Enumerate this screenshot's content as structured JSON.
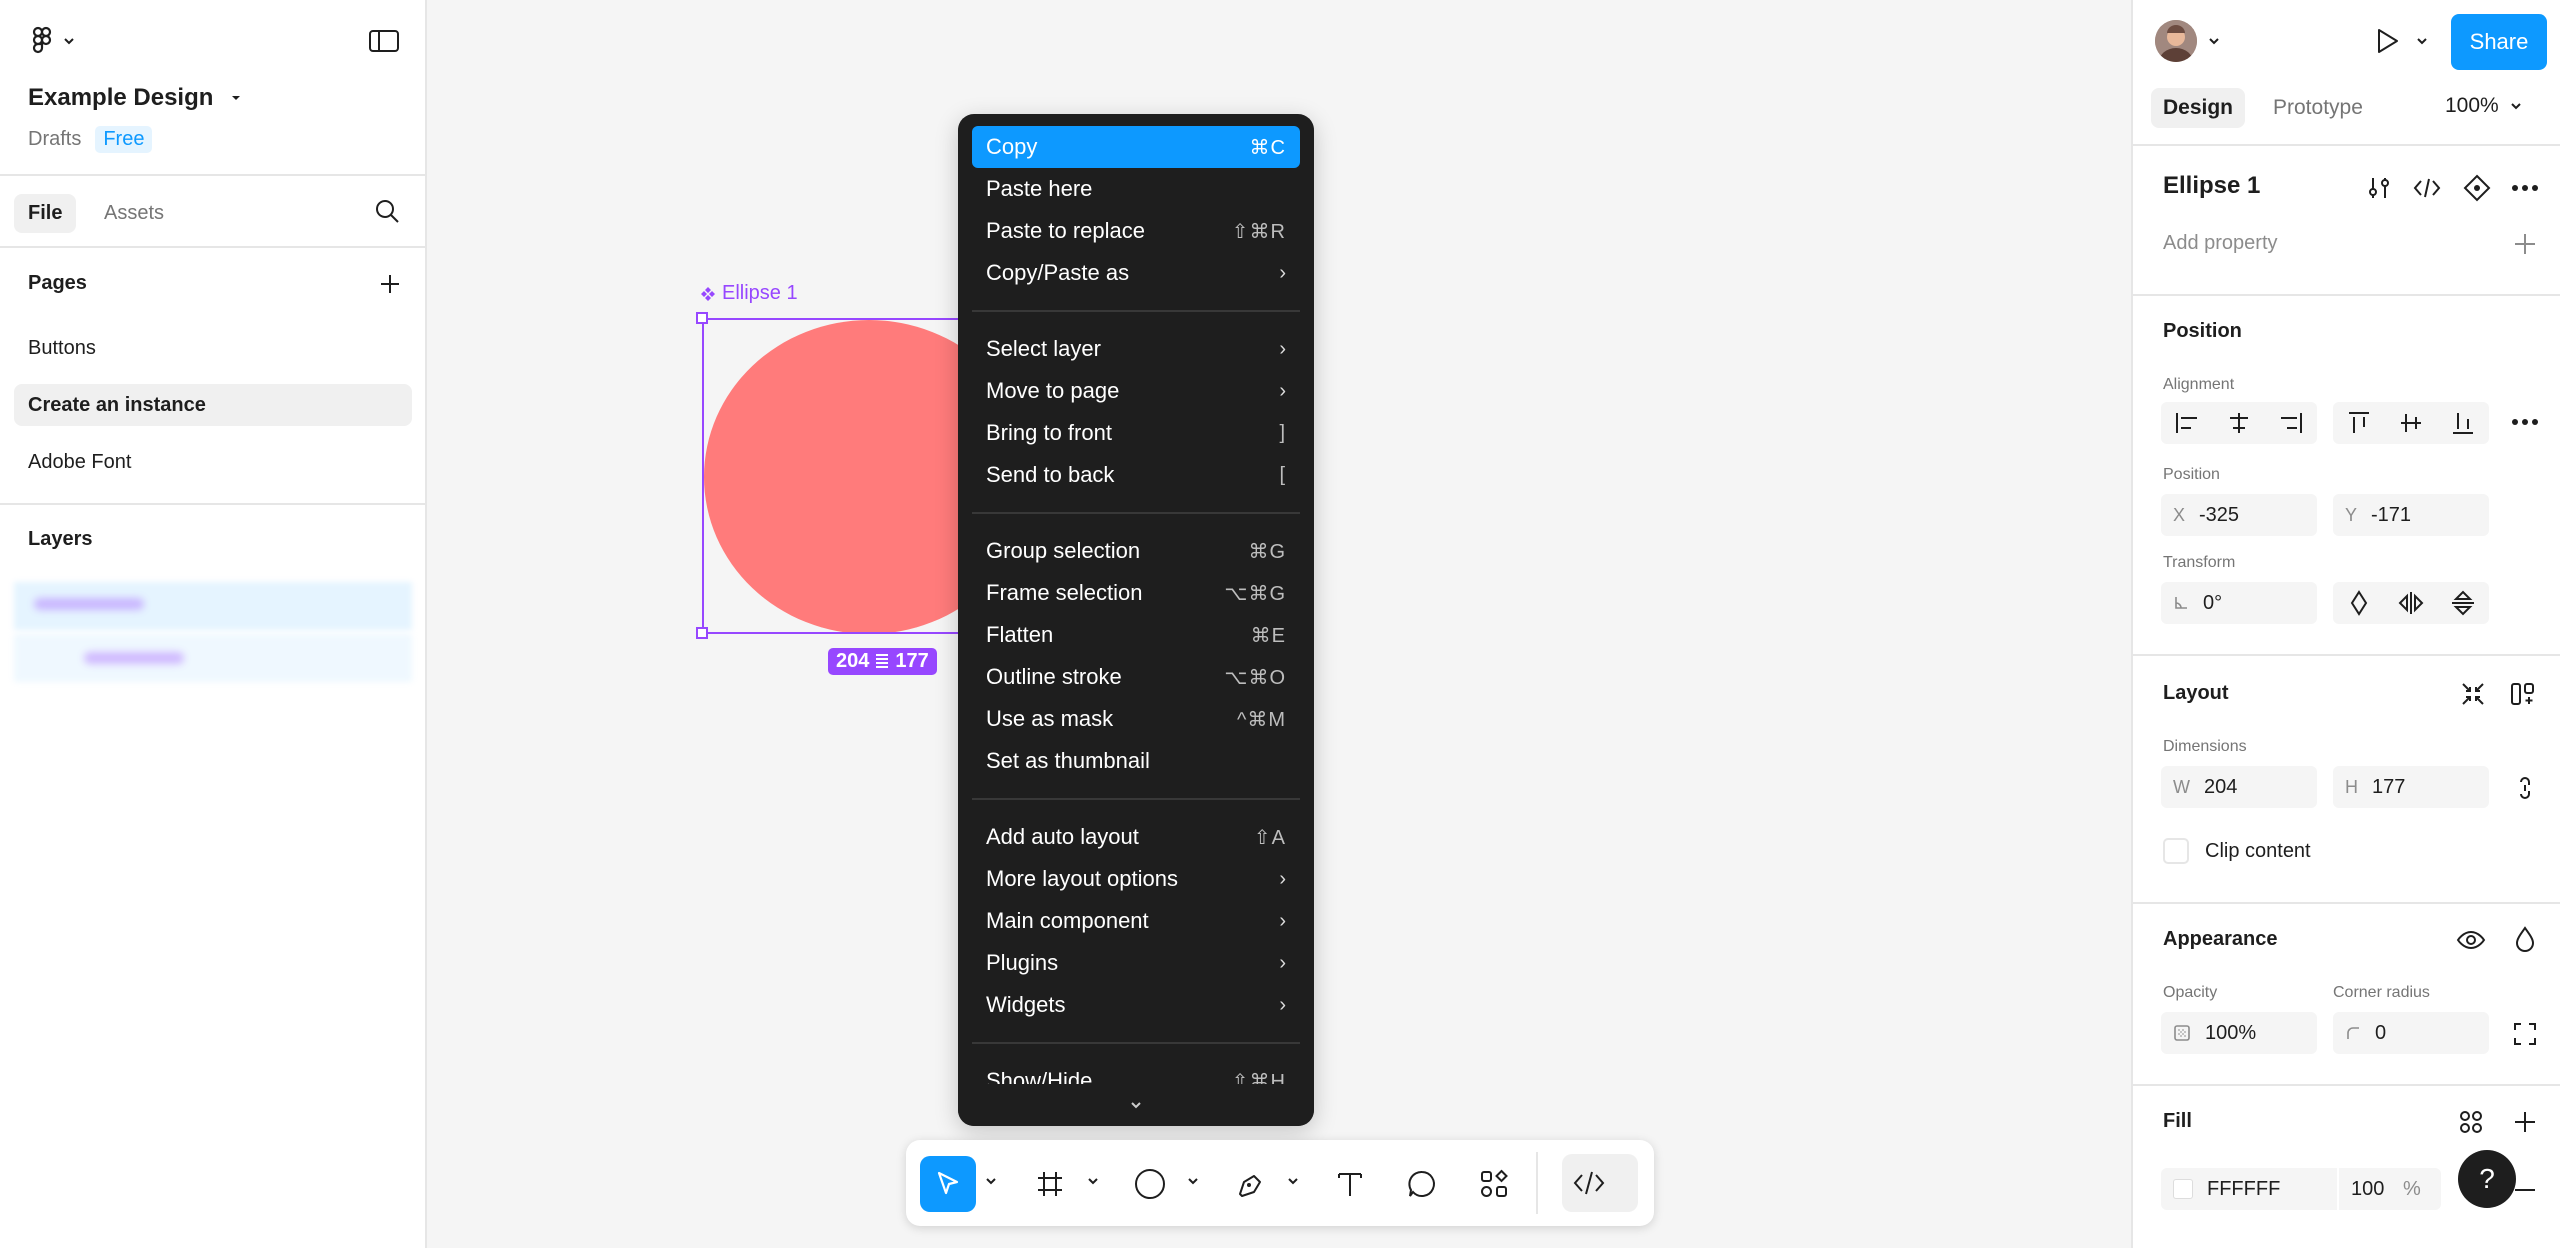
{
  "left": {
    "file_name": "Example Design",
    "location": "Drafts",
    "plan_badge": "Free",
    "tabs": [
      "File",
      "Assets"
    ],
    "pages_title": "Pages",
    "pages": [
      "Buttons",
      "Create an instance",
      "Adobe Font"
    ],
    "layers_title": "Layers"
  },
  "canvas": {
    "selection_label": "Ellipse 1",
    "dim_w": "204",
    "dim_h": "177",
    "ellipse_color": "#ff7b7b"
  },
  "menu": {
    "groups": [
      [
        {
          "label": "Copy",
          "shortcut": "⌘C",
          "highlighted": true
        },
        {
          "label": "Paste here",
          "shortcut": ""
        },
        {
          "label": "Paste to replace",
          "shortcut": "⇧⌘R"
        },
        {
          "label": "Copy/Paste as",
          "submenu": true
        }
      ],
      [
        {
          "label": "Select layer",
          "submenu": true
        },
        {
          "label": "Move to page",
          "submenu": true
        },
        {
          "label": "Bring to front",
          "shortcut": "]"
        },
        {
          "label": "Send to back",
          "shortcut": "["
        }
      ],
      [
        {
          "label": "Group selection",
          "shortcut": "⌘G"
        },
        {
          "label": "Frame selection",
          "shortcut": "⌥⌘G"
        },
        {
          "label": "Flatten",
          "shortcut": "⌘E"
        },
        {
          "label": "Outline stroke",
          "shortcut": "⌥⌘O"
        },
        {
          "label": "Use as mask",
          "shortcut": "^⌘M"
        },
        {
          "label": "Set as thumbnail",
          "shortcut": ""
        }
      ],
      [
        {
          "label": "Add auto layout",
          "shortcut": "⇧A"
        },
        {
          "label": "More layout options",
          "submenu": true
        },
        {
          "label": "Main component",
          "submenu": true
        },
        {
          "label": "Plugins",
          "submenu": true
        },
        {
          "label": "Widgets",
          "submenu": true
        }
      ],
      [
        {
          "label": "Show/Hide",
          "shortcut": "⇧⌘H"
        }
      ]
    ]
  },
  "right": {
    "share_label": "Share",
    "tabs": [
      "Design",
      "Prototype"
    ],
    "zoom": "100%",
    "layer_name": "Ellipse 1",
    "add_property": "Add property",
    "position": {
      "title": "Position",
      "alignment_label": "Alignment",
      "position_label": "Position",
      "x_prefix": "X",
      "x": "-325",
      "y_prefix": "Y",
      "y": "-171",
      "transform_label": "Transform",
      "rotation": "0°"
    },
    "layout": {
      "title": "Layout",
      "dimensions_label": "Dimensions",
      "w_prefix": "W",
      "w": "204",
      "h_prefix": "H",
      "h": "177",
      "clip_label": "Clip content"
    },
    "appearance": {
      "title": "Appearance",
      "opacity_label": "Opacity",
      "opacity": "100%",
      "radius_label": "Corner radius",
      "radius": "0"
    },
    "fill": {
      "title": "Fill",
      "hex": "FFFFFF",
      "opacity": "100",
      "unit": "%"
    },
    "help": "?"
  },
  "colors": {
    "accent": "#0d99ff",
    "component": "#9747ff",
    "menu_bg": "#1e1e1e"
  }
}
